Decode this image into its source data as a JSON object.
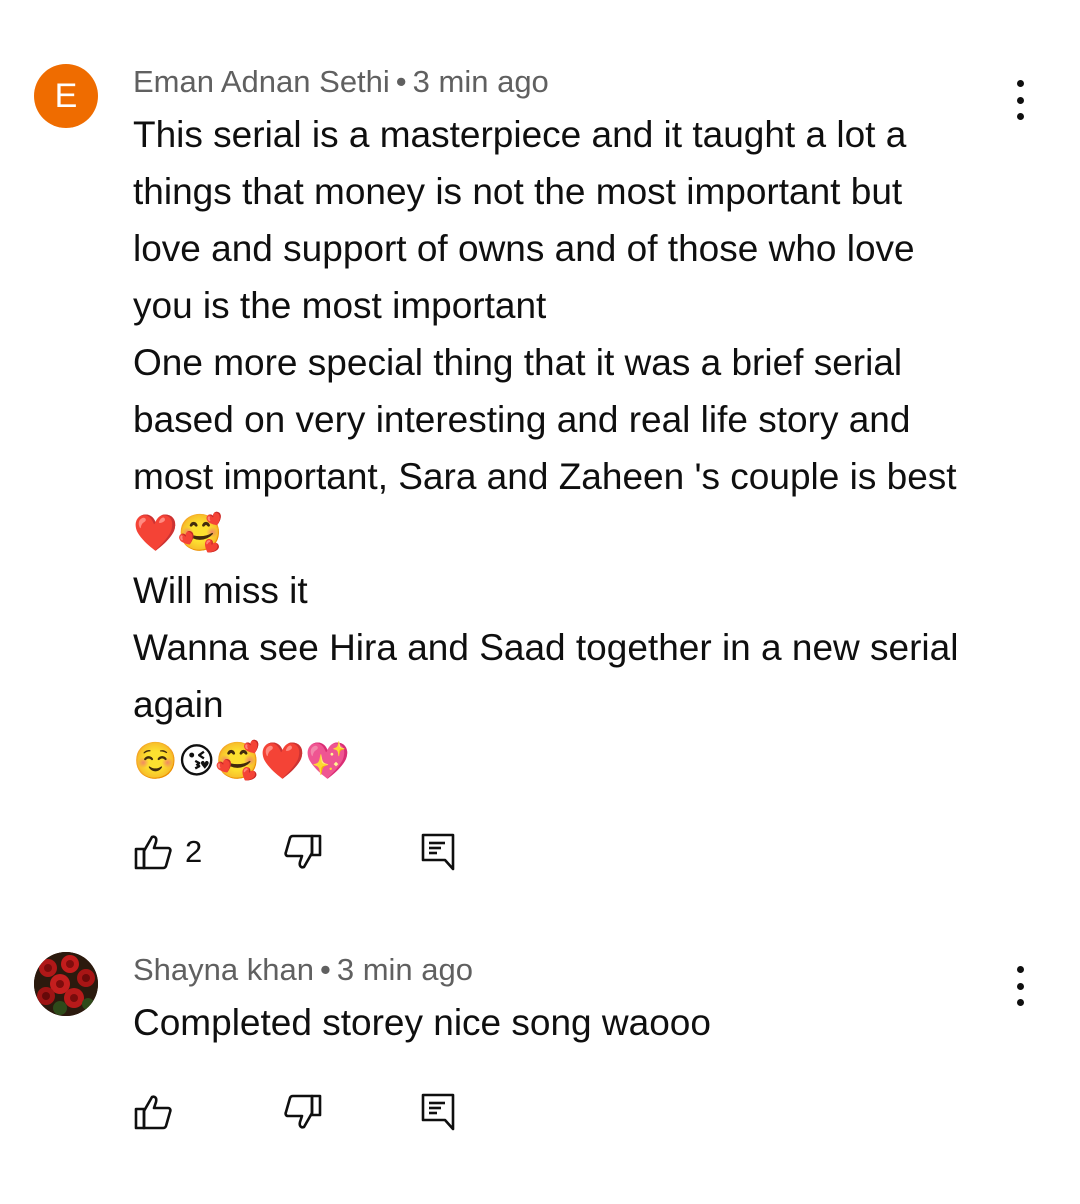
{
  "comments": [
    {
      "author": "Eman Adnan Sethi",
      "separator": "•",
      "time": "3 min ago",
      "avatar_letter": "E",
      "avatar_color": "#ef6c00",
      "lines": [
        "This serial is a masterpiece and it taught a lot a",
        "things that money is not the most important but",
        "love and support of owns and of those who love",
        "you is the most important",
        "One more special thing that it was a brief serial",
        "based on very interesting and real life story and",
        "most important, Sara and Zaheen 's couple is best",
        "❤️🥰",
        "Will miss it",
        "Wanna see Hira and Saad together in a new serial",
        "again",
        "☺️😘🥰❤️💖"
      ],
      "like_count": "2"
    },
    {
      "author": "Shayna khan",
      "separator": "•",
      "time": "3 min ago",
      "avatar_image": "red-roses",
      "lines": [
        "Completed storey nice song waooo"
      ],
      "like_count": ""
    }
  ]
}
